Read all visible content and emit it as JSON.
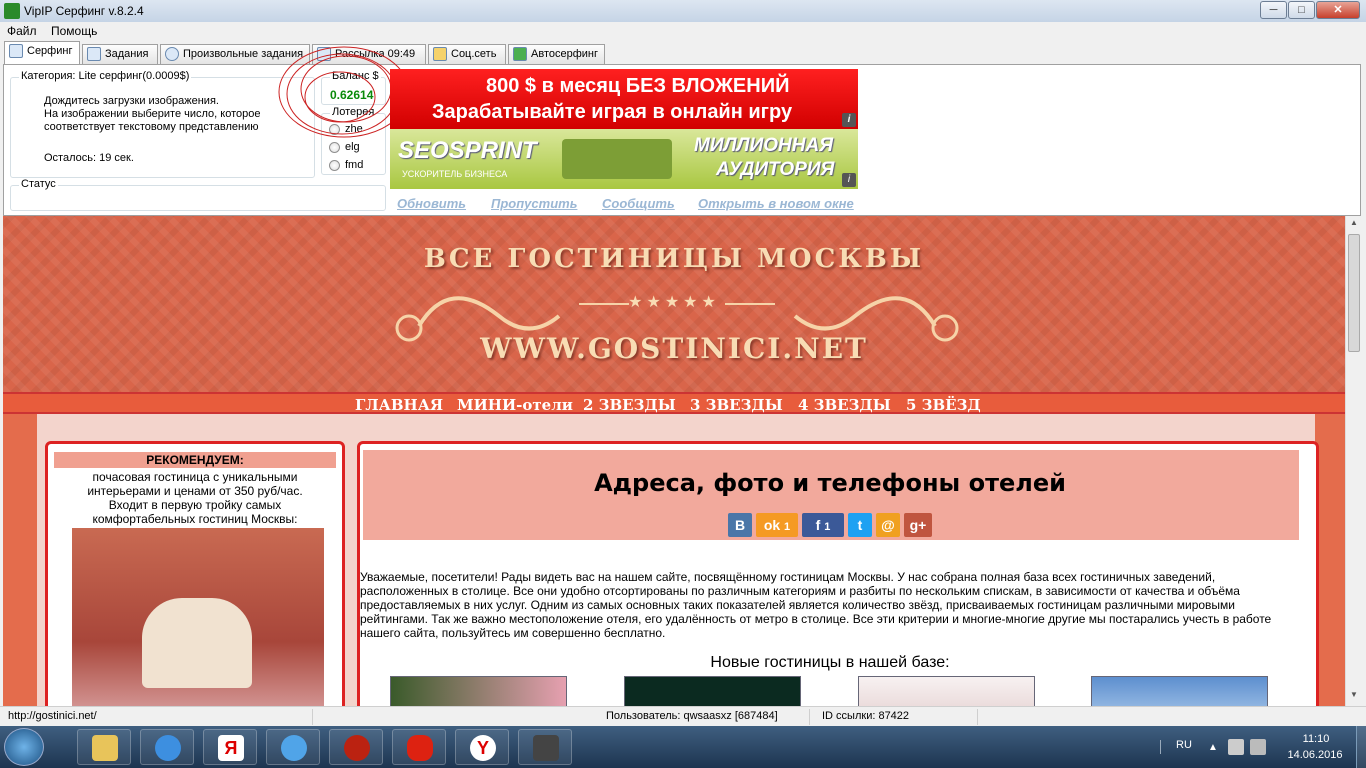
{
  "window": {
    "title": "VipIP Серфинг  v.8.2.4",
    "btn_min": "─",
    "btn_max": "□",
    "btn_close": "✕"
  },
  "menu": {
    "items": [
      "Файл",
      "Помощь"
    ]
  },
  "tabs": [
    {
      "label": "Серфинг",
      "active": true
    },
    {
      "label": "Задания",
      "active": false
    },
    {
      "label": "Произвольные задания",
      "active": false
    },
    {
      "label": "Рассылка 09:49",
      "active": false
    },
    {
      "label": "Соц.сеть",
      "active": false
    },
    {
      "label": "Автосерфинг",
      "active": false
    }
  ],
  "surf": {
    "category_legend": "Категория: Lite серфинг(0.0009$)",
    "instruction_line1": "Дождитесь загрузки изображения.",
    "instruction_line2": "На изображении выберите число, которое",
    "instruction_line3": "соответствует текстовому представлению",
    "remaining": "Осталось: 19 сек.",
    "status_legend": "Статус"
  },
  "balance": {
    "label": "Баланс $",
    "value": "0.62614"
  },
  "lottery": {
    "label": "Лотерея",
    "options": [
      "zhe",
      "elg",
      "fmd"
    ]
  },
  "banners": {
    "b1_line1": "800 $ в месяц  БЕЗ ВЛОЖЕНИЙ",
    "b1_line2": "Зарабатывайте играя в онлайн игру",
    "b2_logo": "SEOSPRINT",
    "b2_tag": "УСКОРИТЕЛЬ БИЗНЕСА",
    "b2_slogan1": "МИЛЛИОННАЯ",
    "b2_slogan2": "АУДИТОРИЯ",
    "info": "i"
  },
  "actions": {
    "refresh": "Обновить",
    "skip": "Пропустить",
    "report": "Сообщить",
    "open_new": "Открыть в новом окне"
  },
  "site": {
    "header_title": "ВСЕ ГОСТИНИЦЫ МОСКВЫ",
    "header_stars": "★★★★★",
    "header_url": "WWW.GOSTINICI.NET",
    "nav": [
      "ГЛАВНАЯ",
      "МИНИ-отели",
      "2 ЗВЕЗДЫ",
      "3 ЗВЕЗДЫ",
      "4 ЗВЕЗДЫ",
      "5 ЗВЁЗД"
    ],
    "recommend_title": "РЕКОМЕНДУЕМ:",
    "recommend_text1": "почасовая гостиница с уникальными",
    "recommend_text2": "интерьерами и ценами от 350 руб/час.",
    "recommend_text3": "Входит в первую тройку самых",
    "recommend_text4": "комфортабельных гостиниц Москвы:",
    "main_title": "Адреса, фото и телефоны отелей",
    "social": {
      "vk": "В",
      "ok": "ok",
      "ok_count": "1",
      "fb": "f",
      "fb_count": "1",
      "tw": "t",
      "mail": "@",
      "gplus": "g+"
    },
    "intro_text": "Уважаемые, посетители! Рады видеть вас на нашем сайте, посвящённому гостиницам Москвы. У нас собрана полная база всех гостиничных заведений, расположенных в столице. Все они удобно отсортированы по различным категориям и разбиты по нескольким спискам, в зависимости от качества и объёма предоставляемых в них услуг. Одним из самых основных таких показателей является количество звёзд, присваиваемых гостиницам различными мировыми рейтингами. Так же важно местоположение отеля, его удалённость от метро в столице. Все эти критерии и многие-многие другие мы постарались учесть в работе нашего сайта, пользуйтесь им совершенно бесплатно.",
    "new_hotels": "Новые гостиницы в нашей базе:"
  },
  "statusbar": {
    "url": "http://gostinici.net/",
    "user": "Пользователь: qwsaasxz [687484]",
    "link_id": "ID ссылки: 87422"
  },
  "taskbar": {
    "lang": "RU",
    "time": "11:10",
    "date": "14.06.2016"
  }
}
